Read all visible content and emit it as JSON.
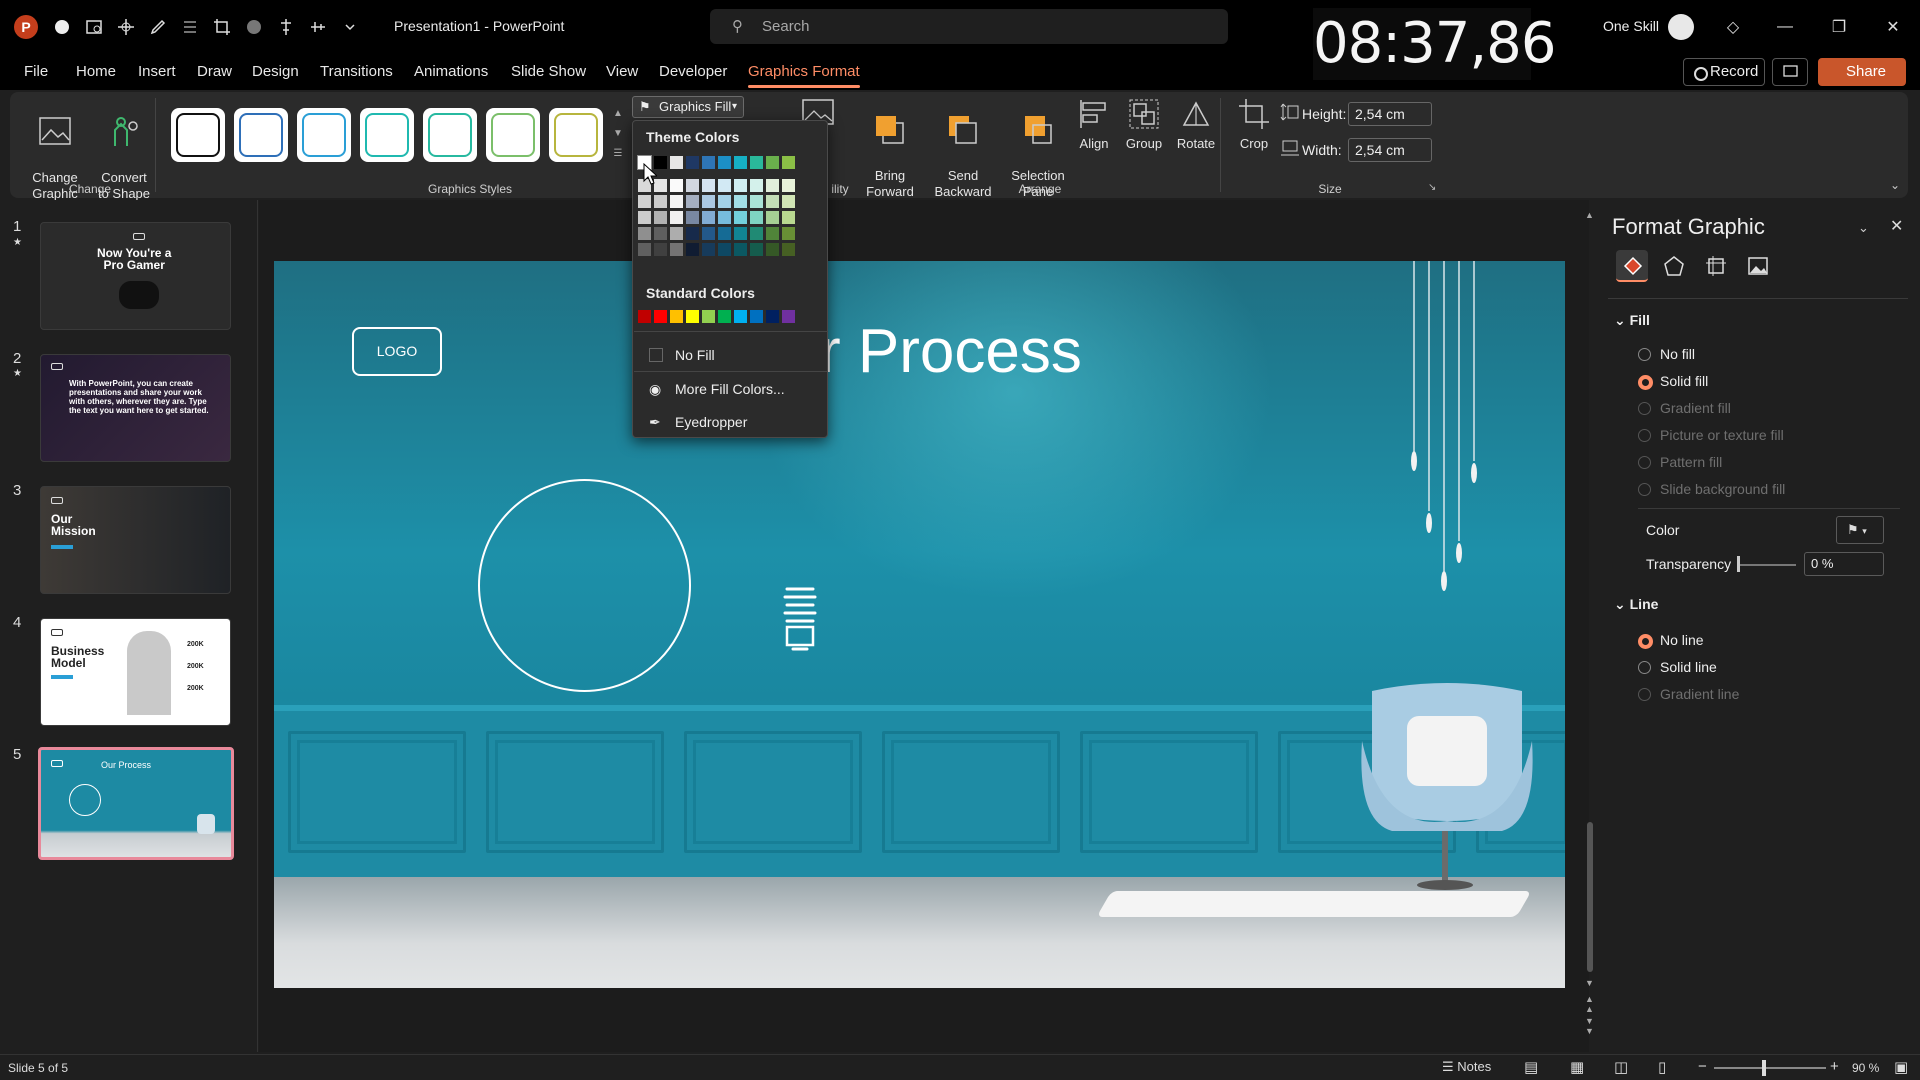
{
  "titlebar": {
    "app_letter": "P",
    "document_title": "Presentation1  -  PowerPoint",
    "search_placeholder": "Search",
    "timer": "08:37,86",
    "user_name": "One Skill"
  },
  "tabs": [
    "File",
    "Home",
    "Insert",
    "Draw",
    "Design",
    "Transitions",
    "Animations",
    "Slide Show",
    "View",
    "Developer",
    "Graphics Format"
  ],
  "active_tab": "Graphics Format",
  "actions": {
    "record": "Record",
    "share": "Share"
  },
  "ribbon": {
    "change_graphic": "Change\nGraphic",
    "convert_to_shape": "Convert\nto Shape",
    "group_change": "Change",
    "group_styles": "Graphics Styles",
    "graphics_fill": "Graphics Fill",
    "accessibility_partial": "ility",
    "bring_forward": "Bring\nForward",
    "send_backward": "Send\nBackward",
    "selection_pane": "Selection\nPane",
    "align": "Align",
    "group": "Group",
    "rotate": "Rotate",
    "group_arrange": "Arrange",
    "crop": "Crop",
    "height_label": "Height:",
    "height_value": "2,54 cm",
    "width_label": "Width:",
    "width_value": "2,54 cm",
    "group_size": "Size",
    "style_colors": [
      "#111111",
      "#2e6fb8",
      "#2a9fd6",
      "#1fb9b0",
      "#27b9a0",
      "#7bbf6a",
      "#b7b53d"
    ]
  },
  "fill_menu": {
    "theme_header": "Theme Colors",
    "theme_colors": [
      "#ffffff",
      "#000000",
      "#e7e6e6",
      "#1f3864",
      "#2e75b6",
      "#1c8fc6",
      "#16b0c4",
      "#2ab89a",
      "#6ab04c",
      "#8bbf46"
    ],
    "standard_header": "Standard Colors",
    "standard_colors": [
      "#c00000",
      "#ff0000",
      "#ffc000",
      "#ffff00",
      "#92d050",
      "#00b050",
      "#00b0f0",
      "#0070c0",
      "#002060",
      "#7030a0"
    ],
    "no_fill": "No Fill",
    "more_colors": "More Fill Colors...",
    "eyedropper": "Eyedropper"
  },
  "thumbnails": [
    {
      "num": "1",
      "star": true,
      "title": "Now You're a\nPro Gamer"
    },
    {
      "num": "2",
      "star": true,
      "title": "With PowerPoint, you can create presentations and share your work with others, wherever they are. Type the text you want here to get started."
    },
    {
      "num": "3",
      "star": false,
      "title": "Our\nMission"
    },
    {
      "num": "4",
      "star": false,
      "title": "Business\nModel",
      "values": [
        "200K",
        "200K",
        "200K"
      ]
    },
    {
      "num": "5",
      "star": false,
      "title": "Our Process"
    }
  ],
  "slide": {
    "logo": "LOGO",
    "title_visible": "r Process"
  },
  "format_panel": {
    "title": "Format Graphic",
    "fill_header": "Fill",
    "fill_options": [
      {
        "label": "No fill",
        "on": false,
        "disabled": false
      },
      {
        "label": "Solid fill",
        "on": true,
        "disabled": false
      },
      {
        "label": "Gradient fill",
        "on": false,
        "disabled": true
      },
      {
        "label": "Picture or texture fill",
        "on": false,
        "disabled": true
      },
      {
        "label": "Pattern fill",
        "on": false,
        "disabled": true
      },
      {
        "label": "Slide background fill",
        "on": false,
        "disabled": true
      }
    ],
    "color_label": "Color",
    "transparency_label": "Transparency",
    "transparency_value": "0 %",
    "line_header": "Line",
    "line_options": [
      {
        "label": "No line",
        "on": true,
        "disabled": false
      },
      {
        "label": "Solid line",
        "on": false,
        "disabled": false
      },
      {
        "label": "Gradient line",
        "on": false,
        "disabled": true
      }
    ]
  },
  "status": {
    "slide_info": "Slide 5 of 5",
    "notes": "Notes",
    "zoom": "90 %"
  }
}
